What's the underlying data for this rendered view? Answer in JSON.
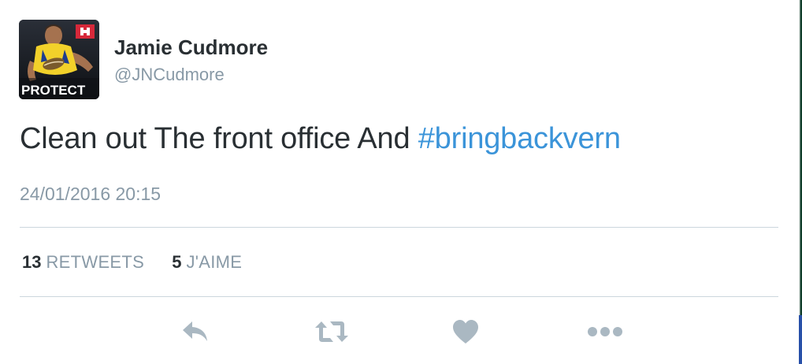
{
  "tweet": {
    "author": {
      "name": "Jamie Cudmore",
      "handle": "@JNCudmore",
      "avatar_caption": "PROTECT"
    },
    "text": "Clean out The front office And",
    "hashtag": "#bringbackvern",
    "timestamp": "24/01/2016 20:15"
  },
  "stats": {
    "retweets": {
      "count": "13",
      "label": "RETWEETS"
    },
    "likes": {
      "count": "5",
      "label": "J'AIME"
    }
  },
  "actions": [
    {
      "icon": "reply-icon"
    },
    {
      "icon": "retweet-icon"
    },
    {
      "icon": "heart-icon"
    },
    {
      "icon": "more-icon"
    }
  ],
  "colors": {
    "text": "#292f33",
    "muted": "#8899a6",
    "hashtag": "#3b94d9",
    "divider": "#ccd6dd",
    "action_icon": "#aab8c2",
    "avatar_jersey": "#f2d12a"
  }
}
